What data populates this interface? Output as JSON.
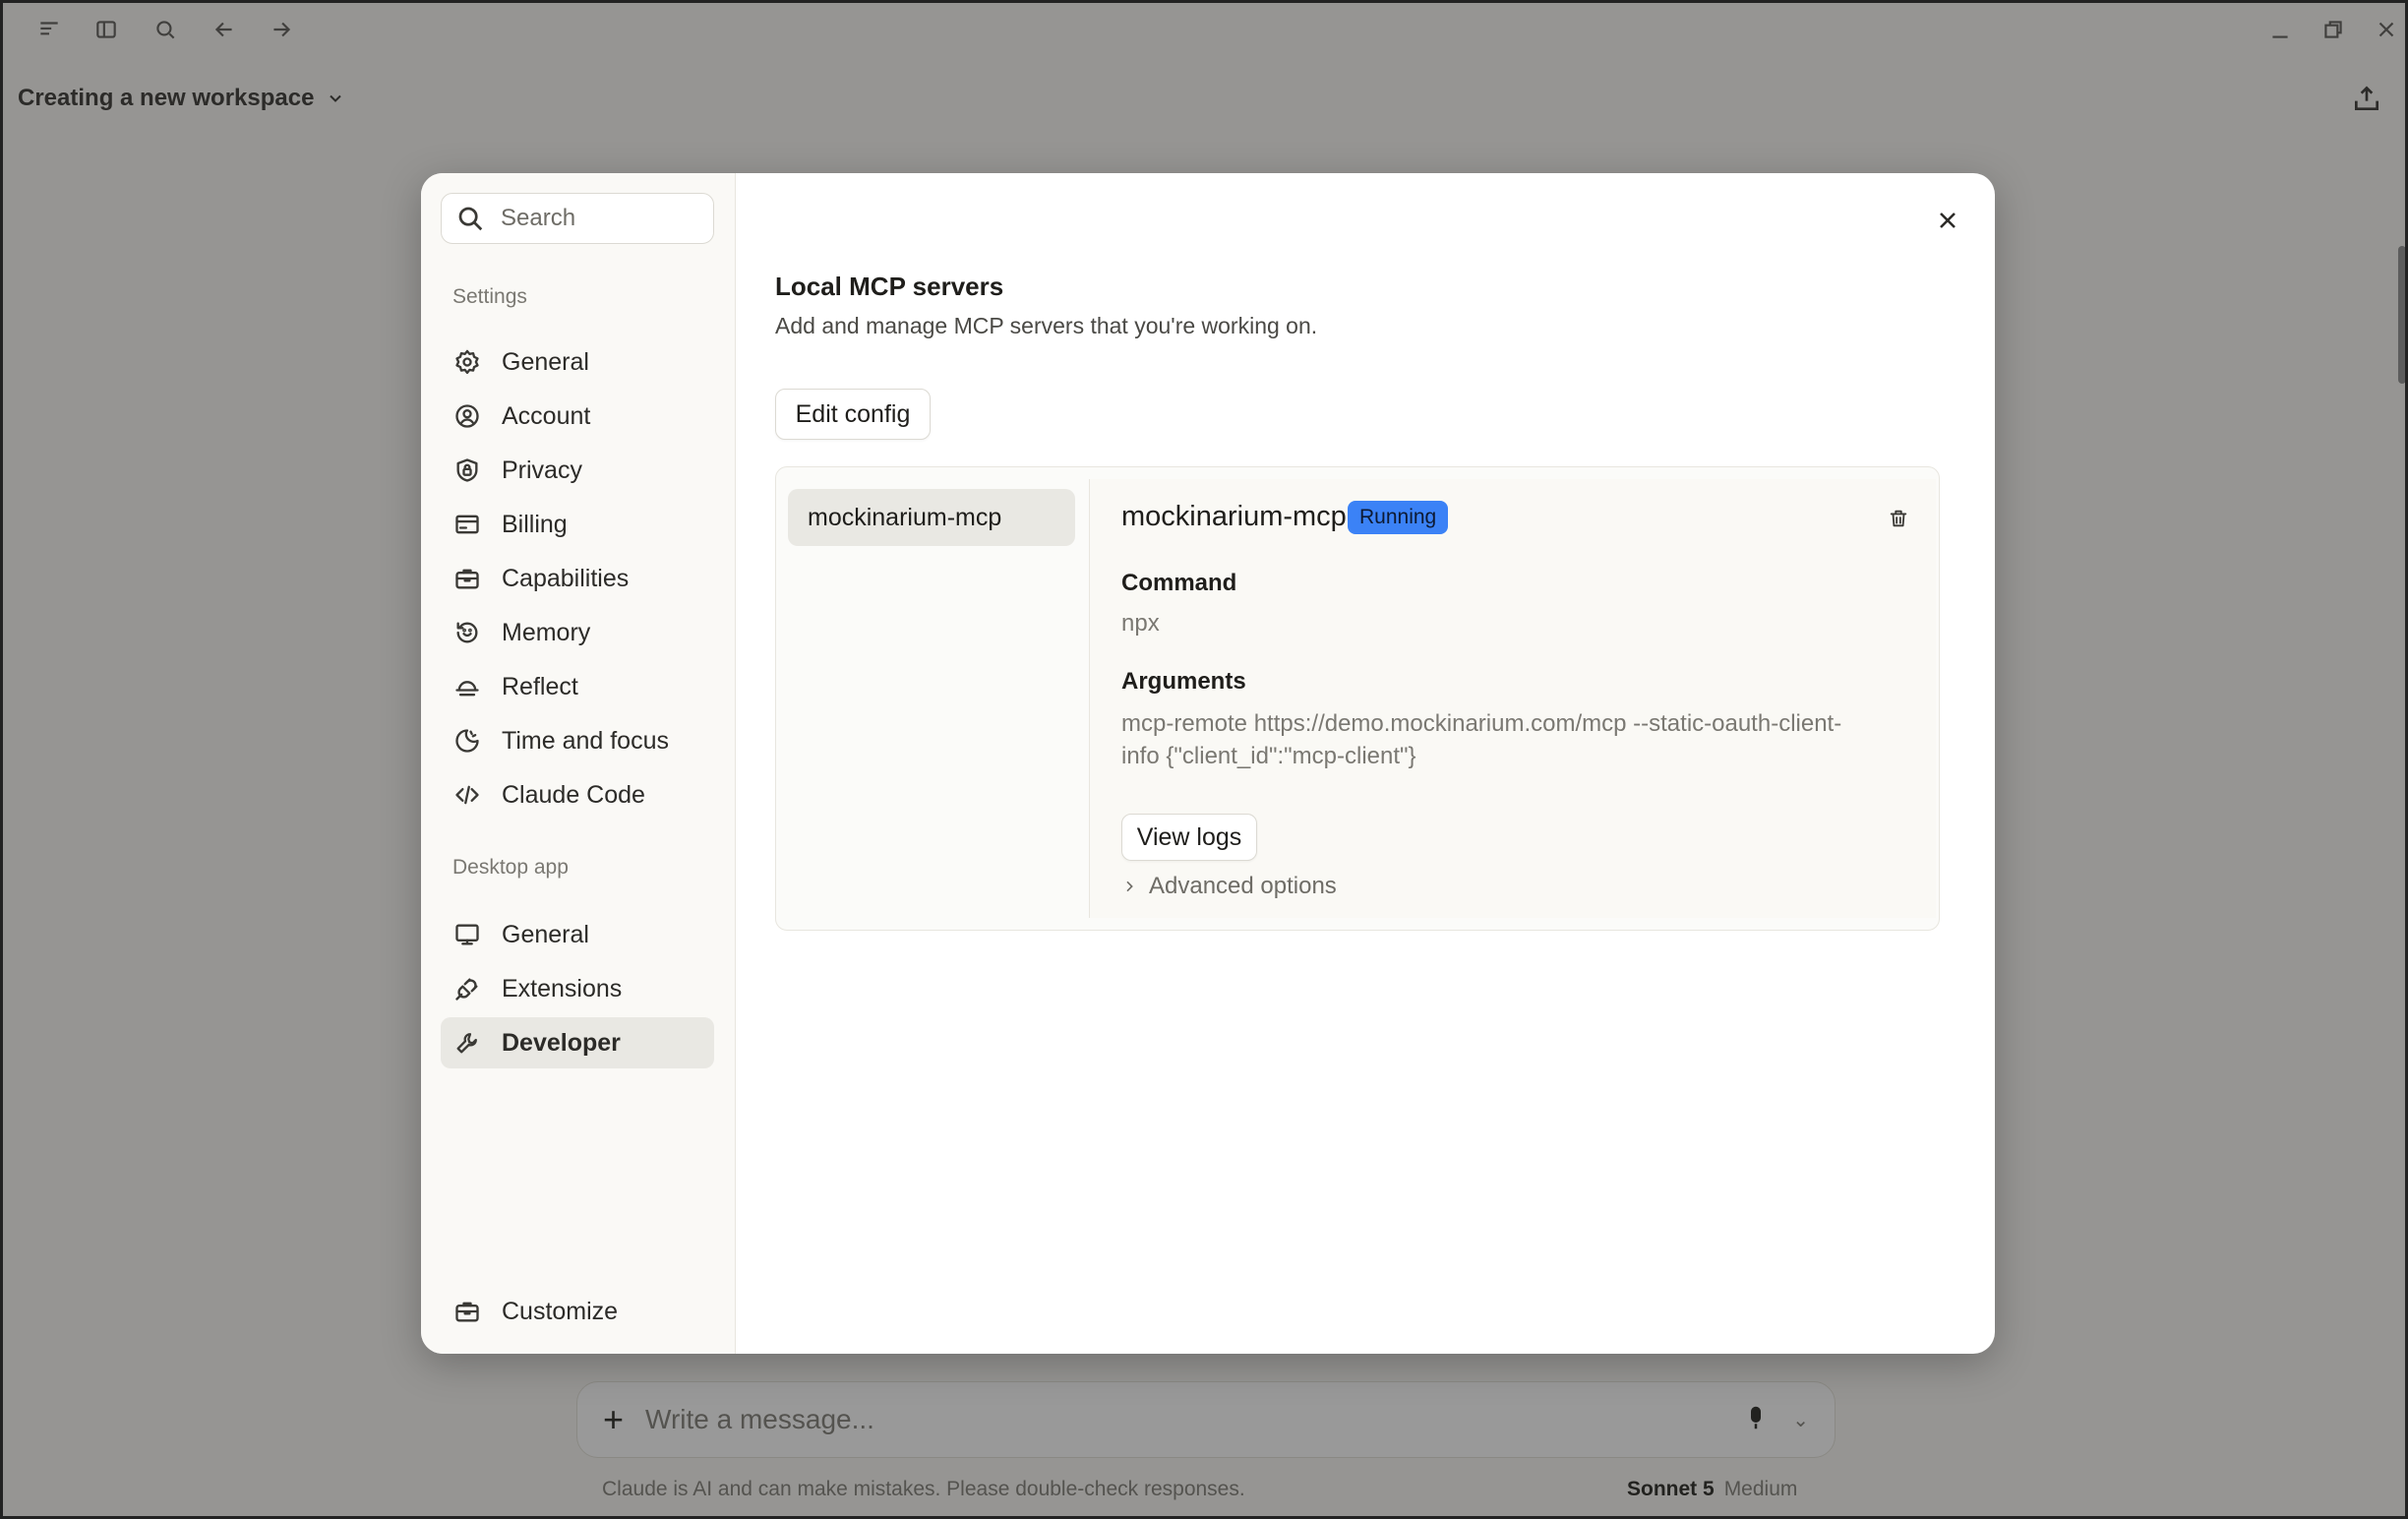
{
  "background": {
    "workspace_title": "Creating a new workspace",
    "composer_placeholder": "Write a message...",
    "disclaimer": "Claude is AI and can make mistakes. Please double-check responses.",
    "model": "Sonnet 5",
    "effort": "Medium"
  },
  "sidebar": {
    "search_placeholder": "Search",
    "settings_label": "Settings",
    "settings_items": [
      {
        "label": "General",
        "icon": "gear-icon"
      },
      {
        "label": "Account",
        "icon": "user-circle-icon"
      },
      {
        "label": "Privacy",
        "icon": "shield-lock-icon"
      },
      {
        "label": "Billing",
        "icon": "credit-card-icon"
      },
      {
        "label": "Capabilities",
        "icon": "briefcase-icon"
      },
      {
        "label": "Memory",
        "icon": "memory-icon"
      },
      {
        "label": "Reflect",
        "icon": "sunrise-icon"
      },
      {
        "label": "Time and focus",
        "icon": "moon-icon"
      },
      {
        "label": "Claude Code",
        "icon": "code-icon"
      }
    ],
    "desktop_label": "Desktop app",
    "desktop_items": [
      {
        "label": "General",
        "icon": "monitor-icon"
      },
      {
        "label": "Extensions",
        "icon": "plug-icon"
      },
      {
        "label": "Developer",
        "icon": "wrench-icon",
        "active": true
      }
    ],
    "customize": {
      "label": "Customize",
      "icon": "briefcase-icon"
    }
  },
  "main": {
    "title": "Local MCP servers",
    "subtitle": "Add and manage MCP servers that you're working on.",
    "edit_config_label": "Edit config",
    "servers": [
      {
        "name": "mockinarium-mcp"
      }
    ],
    "detail": {
      "name": "mockinarium-mcp",
      "status": "Running",
      "status_color": "#3b82f6",
      "command_label": "Command",
      "command": "npx",
      "arguments_label": "Arguments",
      "arguments_line1": "mcp-remote https://demo.mockinarium.com/mcp --static-oauth-client-",
      "arguments_line2": "info {\"client_id\":\"mcp-client\"}",
      "view_logs_label": "View logs",
      "advanced_label": "Advanced options"
    }
  }
}
